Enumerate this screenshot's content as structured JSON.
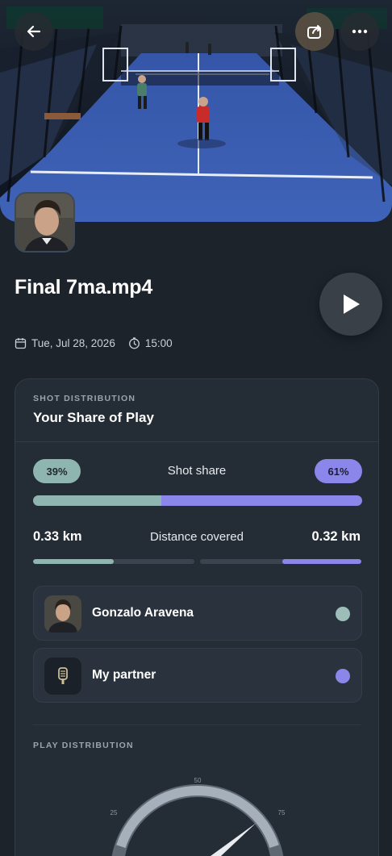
{
  "video": {
    "title": "Final 7ma.mp4",
    "date": "Tue, Jul 28, 2026",
    "duration": "15:00"
  },
  "icons": {
    "back": "arrow-left-icon",
    "share": "share-icon",
    "more": "more-horizontal-icon",
    "play": "play-icon",
    "calendar": "calendar-icon",
    "clock": "clock-icon",
    "racket": "padel-racket-icon"
  },
  "shot_distribution": {
    "eyebrow": "SHOT DISTRIBUTION",
    "title": "Your Share of Play",
    "shot_share_label": "Shot share",
    "left_share": "39%",
    "right_share": "61%",
    "left_share_value": 39,
    "right_share_value": 61,
    "distance_label": "Distance covered",
    "left_distance": "0.33 km",
    "right_distance": "0.32 km",
    "left_distance_fraction": 0.5,
    "right_distance_fraction": 0.49
  },
  "players": [
    {
      "name": "Gonzalo Aravena",
      "color": "#9cbdb8"
    },
    {
      "name": "My partner",
      "color": "#8a86ea"
    }
  ],
  "play_distribution": {
    "eyebrow": "PLAY DISTRIBUTION",
    "ticks": [
      "25",
      "50",
      "75"
    ],
    "value": 78
  },
  "colors": {
    "left_accent": "#8fb5b0",
    "right_accent": "#8a86ea",
    "background": "#1c232b"
  }
}
